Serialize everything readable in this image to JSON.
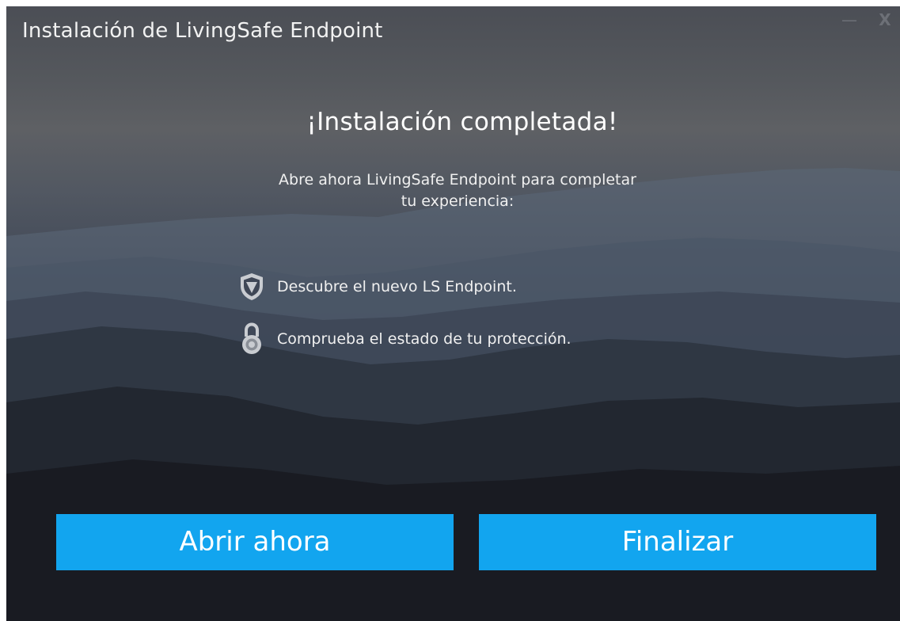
{
  "window": {
    "title": "Instalación de LivingSafe Endpoint",
    "minimize_glyph": "—",
    "close_glyph": "X"
  },
  "content": {
    "heading": "¡Instalación completada!",
    "subtitle_line1": "Abre ahora LivingSafe Endpoint para completar",
    "subtitle_line2": "tu experiencia:",
    "features": [
      {
        "icon": "shield-icon",
        "label": "Descubre el nuevo LS Endpoint."
      },
      {
        "icon": "lock-icon",
        "label": "Comprueba el estado de tu protección."
      }
    ]
  },
  "buttons": {
    "open_label": "Abrir ahora",
    "finish_label": "Finalizar"
  },
  "colors": {
    "button_bg": "#12a5ef",
    "text": "#ffffff",
    "window_controls": "#6d7077"
  }
}
